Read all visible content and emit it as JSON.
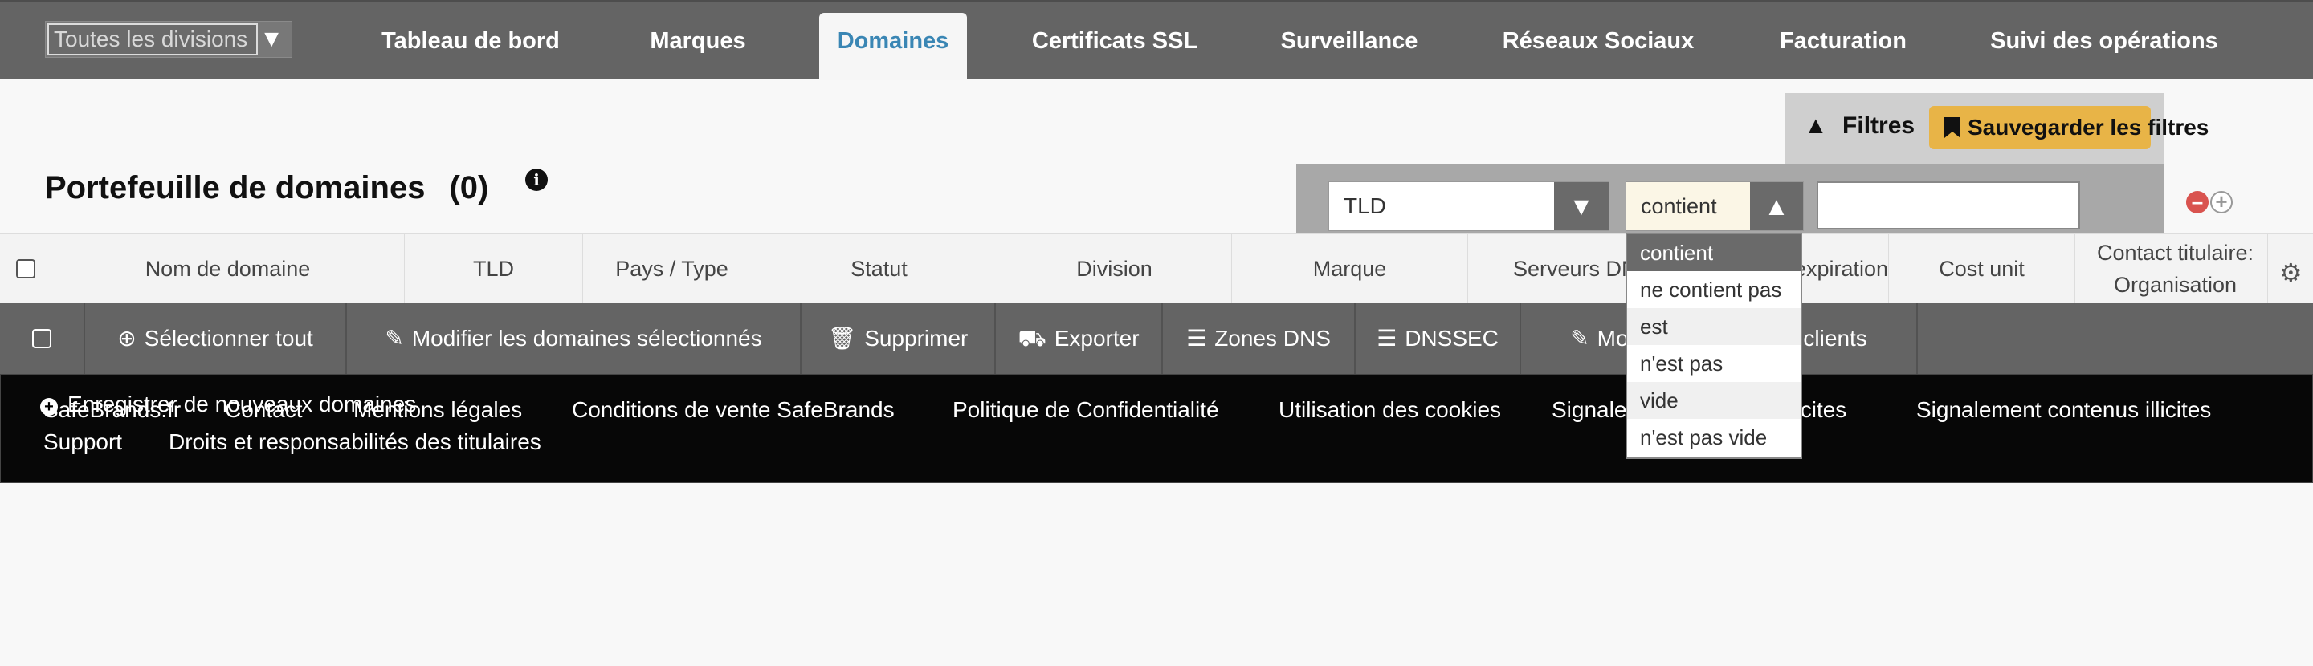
{
  "nav": {
    "division_select": "Toutes les divisions",
    "tabs": [
      {
        "label": "Tableau de bord"
      },
      {
        "label": "Marques"
      },
      {
        "label": "Domaines"
      },
      {
        "label": "Certificats SSL"
      },
      {
        "label": "Surveillance"
      },
      {
        "label": "Réseaux Sociaux"
      },
      {
        "label": "Facturation"
      },
      {
        "label": "Suivi des opérations"
      }
    ],
    "active_tab": "Domaines"
  },
  "filters": {
    "toggle_label": "Filtres",
    "save_label": "Sauvegarder les filtres",
    "field_value": "TLD",
    "operator_value": "contient",
    "text_value": "",
    "operator_options": [
      "contient",
      "ne contient pas",
      "est",
      "n'est pas",
      "vide",
      "n'est pas vide"
    ]
  },
  "page": {
    "title": "Portefeuille de domaines",
    "count": "(0)"
  },
  "table": {
    "columns": [
      "Nom de domaine",
      "TLD",
      "Pays / Type",
      "Statut",
      "Division",
      "Marque",
      "Serveurs DNS",
      "Date d'expiration",
      "Cost unit",
      "Contact titulaire: Organisation"
    ]
  },
  "actions": {
    "select_all": "Sélectionner tout",
    "edit_selected": "Modifier les domaines sélectionnés",
    "delete": "Supprimer",
    "export": "Exporter",
    "dns_zones": "Zones DNS",
    "dnssec": "DNSSEC",
    "edit_clients": "Modifier les champs clients",
    "register_new": "Enregistrer de nouveaux domaines"
  },
  "footer": {
    "links": [
      "SafeBrands.fr",
      "Contact",
      "Mentions légales",
      "Conditions de vente SafeBrands",
      "Politique de Confidentialité",
      "Utilisation des cookies",
      "Signalement contenus illicites",
      "Signalement contenus illicites",
      "Support",
      "Droits et responsabilités des titulaires"
    ]
  },
  "colors": {
    "nav_bg": "#646464",
    "active_tab_text": "#3a86b4",
    "save_button": "#e8b447",
    "footer_bg": "#070707"
  }
}
